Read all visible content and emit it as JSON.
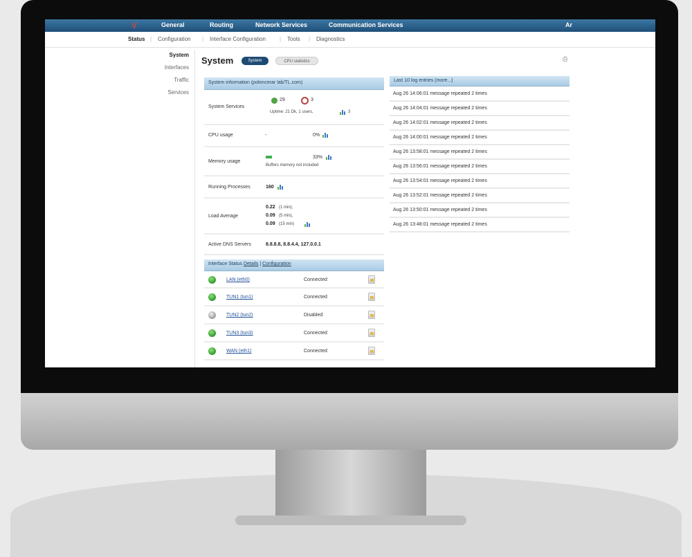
{
  "top_nav": {
    "items": [
      "General",
      "Routing",
      "Network Services",
      "Communication Services"
    ],
    "user": "Ar"
  },
  "sub_nav": {
    "items": [
      "Status",
      "Configuration",
      "Interface Configuration",
      "Tools",
      "Diagnostics"
    ],
    "active": "Status"
  },
  "sidebar": {
    "items": [
      "System",
      "Interfaces",
      "Traffic",
      "Services"
    ],
    "active": "System"
  },
  "page": {
    "title": "System",
    "tabs": [
      "System",
      "CPU statistics"
    ],
    "active_tab": "System"
  },
  "system_info": {
    "header": "System information (poloncerar lab/TL.com)",
    "services": {
      "label": "System Services",
      "running": "29",
      "stopped": "3",
      "uptime": "Uptime: 21 Dk, 1 users,",
      "uptime_suffix": "3"
    },
    "cpu": {
      "label": "CPU usage",
      "dash": "-",
      "value": "0%"
    },
    "memory": {
      "label": "Memory usage",
      "value": "33%",
      "note": "Buffers memory not included"
    },
    "processes": {
      "label": "Running Processes",
      "value": "160"
    },
    "load": {
      "label": "Load Average",
      "l1": "0.22",
      "l1_suffix": "(1 min),",
      "l5": "0.09",
      "l5_suffix": "(5 min),",
      "l15": "0.09",
      "l15_suffix": "(15 min)"
    },
    "dns": {
      "label": "Active DNS Servers",
      "value": "8.8.8.8, 8.8.4.4, 127.0.0.1"
    }
  },
  "interface_status": {
    "header": "Interface Status",
    "header_link1": "Details",
    "header_sep": "|",
    "header_link2": "Configuration",
    "rows": [
      {
        "name": "LAN (eth0)",
        "status": "Connected",
        "state": "on"
      },
      {
        "name": "TUN1 (tun1)",
        "status": "Connected",
        "state": "on"
      },
      {
        "name": "TUN2 (tun2)",
        "status": "Disabled",
        "state": "off"
      },
      {
        "name": "TUN3 (tun3)",
        "status": "Connected",
        "state": "on"
      },
      {
        "name": "WAN (eth1)",
        "status": "Connected",
        "state": "on"
      }
    ]
  },
  "log": {
    "header": "Last 10 log entries (more...)",
    "entries": [
      "Aug 26 14:06:01 message repeated 2 times",
      "Aug 26 14:04:01 message repeated 2 times",
      "Aug 26 14:02:01 message repeated 2 times",
      "Aug 26 14:00:01 message repeated 2 times",
      "Aug 26 13:58:01 message repeated 2 times",
      "Aug 26 13:56:01 message repeated 2 times",
      "Aug 26 13:54:01 message repeated 2 times",
      "Aug 26 13:52:01 message repeated 2 times",
      "Aug 26 13:50:01 message repeated 2 times",
      "Aug 26 13:48:01 message repeated 2 times"
    ]
  },
  "colors": {
    "nav_bar": "#1f4f78",
    "panel_header": "#a9cbe4",
    "status_ok": "#2f9a2a",
    "status_off": "#9a9a9a"
  }
}
